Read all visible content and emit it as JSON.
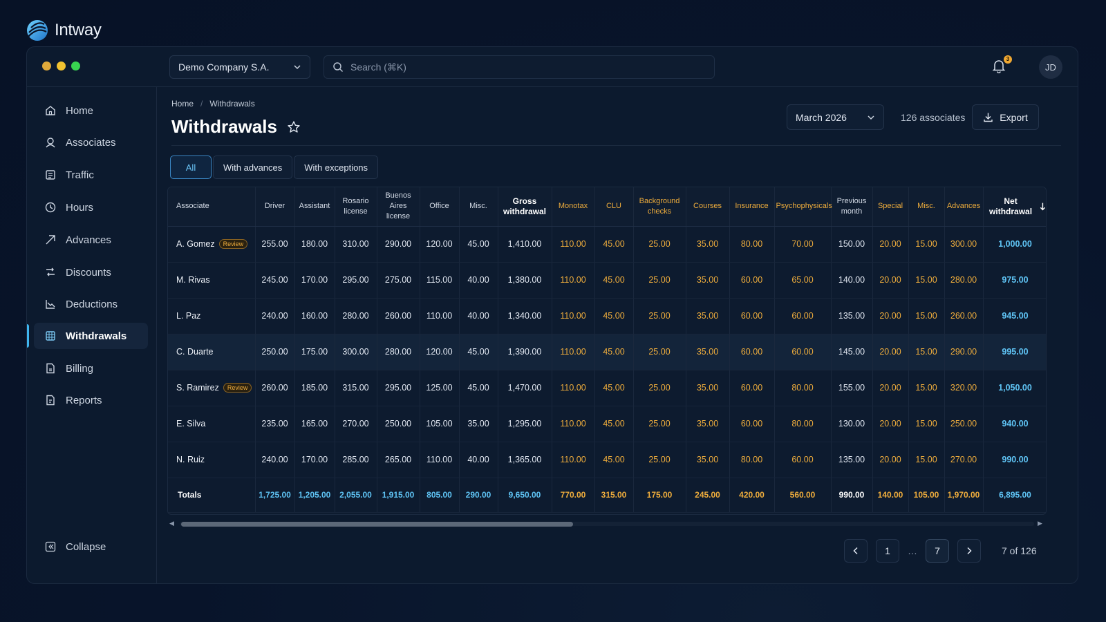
{
  "brand": {
    "name": "Intway"
  },
  "colors": {
    "accent": "#3fb5ef",
    "amber": "#efad3c",
    "dot_yellow": "#e9b33d",
    "dot_amber": "#f1c232",
    "dot_green": "#39d353"
  },
  "topbar": {
    "company": "Demo Company S.A.",
    "search_placeholder": "Search (⌘K)",
    "notifications_count": "3",
    "avatar_initials": "JD"
  },
  "sidebar": {
    "items": [
      {
        "label": "Home",
        "icon": "home-icon"
      },
      {
        "label": "Associates",
        "icon": "associates-icon"
      },
      {
        "label": "Traffic",
        "icon": "traffic-icon"
      },
      {
        "label": "Hours",
        "icon": "clock-icon"
      },
      {
        "label": "Advances",
        "icon": "advances-icon"
      },
      {
        "label": "Discounts",
        "icon": "discounts-icon"
      },
      {
        "label": "Deductions",
        "icon": "deductions-icon"
      },
      {
        "label": "Withdrawals",
        "icon": "withdrawals-icon",
        "active": true
      },
      {
        "label": "Billing",
        "icon": "billing-icon"
      },
      {
        "label": "Reports",
        "icon": "reports-icon"
      }
    ],
    "collapse_label": "Collapse"
  },
  "page": {
    "breadcrumb": [
      "Home",
      "Withdrawals"
    ],
    "title": "Withdrawals",
    "month": "March 2026",
    "associates_count": "126 associates",
    "export_label": "Export"
  },
  "filters": [
    "All",
    "With advances",
    "With exceptions"
  ],
  "table": {
    "columns": [
      "Associate",
      "Driver",
      "Assistant",
      "Rosario license",
      "Buenos Aires license",
      "Office",
      "Misc.",
      "Gross withdrawal",
      "Monotax",
      "CLU",
      "Background checks",
      "Courses",
      "Insurance",
      "Psychophysicals",
      "Previous month",
      "Special",
      "Misc.",
      "Advances",
      "Net withdrawal"
    ],
    "review_label": "Review",
    "rows": [
      {
        "name": "A. Gomez",
        "review": true,
        "values": [
          "255.00",
          "180.00",
          "310.00",
          "290.00",
          "120.00",
          "45.00",
          "1,410.00",
          "110.00",
          "45.00",
          "25.00",
          "35.00",
          "80.00",
          "70.00",
          "150.00",
          "20.00",
          "15.00",
          "300.00",
          "1,000.00"
        ]
      },
      {
        "name": "M. Rivas",
        "review": false,
        "values": [
          "245.00",
          "170.00",
          "295.00",
          "275.00",
          "115.00",
          "40.00",
          "1,380.00",
          "110.00",
          "45.00",
          "25.00",
          "35.00",
          "60.00",
          "65.00",
          "140.00",
          "20.00",
          "15.00",
          "280.00",
          "975.00"
        ]
      },
      {
        "name": "L. Paz",
        "review": false,
        "values": [
          "240.00",
          "160.00",
          "280.00",
          "260.00",
          "110.00",
          "40.00",
          "1,340.00",
          "110.00",
          "45.00",
          "25.00",
          "35.00",
          "60.00",
          "60.00",
          "135.00",
          "20.00",
          "15.00",
          "260.00",
          "945.00"
        ]
      },
      {
        "name": "C. Duarte",
        "review": false,
        "values": [
          "250.00",
          "175.00",
          "300.00",
          "280.00",
          "120.00",
          "45.00",
          "1,390.00",
          "110.00",
          "45.00",
          "25.00",
          "35.00",
          "60.00",
          "60.00",
          "145.00",
          "20.00",
          "15.00",
          "290.00",
          "995.00"
        ]
      },
      {
        "name": "S. Ramirez",
        "review": true,
        "values": [
          "260.00",
          "185.00",
          "315.00",
          "295.00",
          "125.00",
          "45.00",
          "1,470.00",
          "110.00",
          "45.00",
          "25.00",
          "35.00",
          "60.00",
          "80.00",
          "155.00",
          "20.00",
          "15.00",
          "320.00",
          "1,050.00"
        ]
      },
      {
        "name": "E. Silva",
        "review": false,
        "values": [
          "235.00",
          "165.00",
          "270.00",
          "250.00",
          "105.00",
          "35.00",
          "1,295.00",
          "110.00",
          "45.00",
          "25.00",
          "35.00",
          "60.00",
          "80.00",
          "130.00",
          "20.00",
          "15.00",
          "250.00",
          "940.00"
        ]
      },
      {
        "name": "N. Ruiz",
        "review": false,
        "values": [
          "240.00",
          "170.00",
          "285.00",
          "265.00",
          "110.00",
          "40.00",
          "1,365.00",
          "110.00",
          "45.00",
          "25.00",
          "35.00",
          "80.00",
          "60.00",
          "135.00",
          "20.00",
          "15.00",
          "270.00",
          "990.00"
        ]
      }
    ],
    "totals": {
      "label": "Totals",
      "values": [
        "1,725.00",
        "1,205.00",
        "2,055.00",
        "1,915.00",
        "805.00",
        "290.00",
        "9,650.00",
        "770.00",
        "315.00",
        "175.00",
        "245.00",
        "420.00",
        "560.00",
        "990.00",
        "140.00",
        "105.00",
        "1,970.00",
        "6,895.00"
      ]
    }
  },
  "pagination": {
    "pages": [
      "1",
      "…",
      "7"
    ],
    "info": "7 of 126"
  }
}
